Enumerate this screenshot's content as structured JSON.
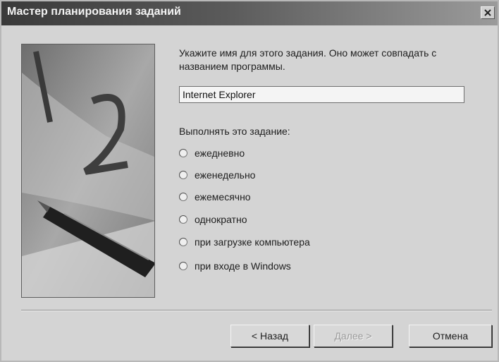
{
  "window": {
    "title": "Мастер планирования заданий"
  },
  "prompt": {
    "text": "Укажите имя для этого задания. Оно может совпадать с названием программы."
  },
  "task_name": {
    "value": "Internet Explorer"
  },
  "schedule": {
    "label": "Выполнять это задание:",
    "options": [
      "ежедневно",
      "еженедельно",
      "ежемесячно",
      "однократно",
      "при загрузке компьютера",
      "при входе в Windows"
    ]
  },
  "buttons": {
    "back": "< Назад",
    "next": "Далее >",
    "cancel": "Отмена"
  }
}
